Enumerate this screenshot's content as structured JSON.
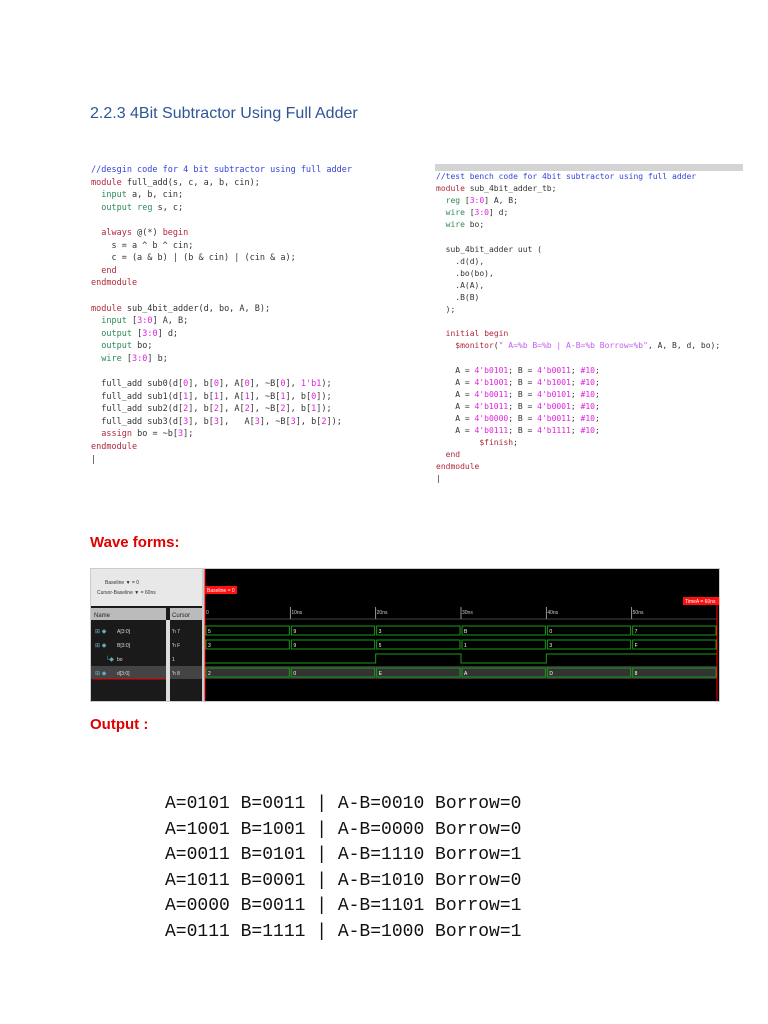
{
  "title": "2.2.3 4Bit Subtractor Using Full Adder",
  "design_code": [
    "//desgin code for 4 bit subtractor using full adder",
    "module full_add(s, c, a, b, cin);",
    "  input a, b, cin;",
    "  output reg s, c;",
    "",
    "  always @(*) begin",
    "    s = a ^ b ^ cin;",
    "    c = (a & b) | (b & cin) | (cin & a);",
    "  end",
    "endmodule",
    "",
    "module sub_4bit_adder(d, bo, A, B);",
    "  input [3:0] A, B;",
    "  output [3:0] d;",
    "  output bo;",
    "  wire [3:0] b;",
    "",
    "  full_add sub0(d[0], b[0], A[0], ~B[0], 1'b1);",
    "  full_add sub1(d[1], b[1], A[1], ~B[1], b[0]);",
    "  full_add sub2(d[2], b[2], A[2], ~B[2], b[1]);",
    "  full_add sub3(d[3], b[3],   A[3], ~B[3], b[2]);",
    "  assign bo = ~b[3];",
    "endmodule",
    "|"
  ],
  "testbench_code": [
    "//test bench code for 4bit subtractor using full adder",
    "module sub_4bit_adder_tb;",
    "  reg [3:0] A, B;",
    "  wire [3:0] d;",
    "  wire bo;",
    "",
    "  sub_4bit_adder uut (",
    "    .d(d),",
    "    .bo(bo),",
    "    .A(A),",
    "    .B(B)",
    "  );",
    "",
    "  initial begin",
    "    $monitor(\" A=%b B=%b | A-B=%b Borrow=%b\", A, B, d, bo);",
    "",
    "    A = 4'b0101; B = 4'b0011; #10;",
    "    A = 4'b1001; B = 4'b1001; #10;",
    "    A = 4'b0011; B = 4'b0101; #10;",
    "    A = 4'b1011; B = 4'b0001; #10;",
    "    A = 4'b0000; B = 4'b0011; #10;",
    "    A = 4'b0111; B = 4'b1111; #10;",
    "         $finish;",
    "  end",
    "endmodule",
    "|"
  ],
  "waveforms_label": "Wave forms:",
  "waveform": {
    "baseline_label": "Baseline ▼ = 0",
    "cursor_baseline_label": "Cursor-Baseline ▼ = 60ns",
    "baseline_marker": "Baseline = 0",
    "timea_marker": "TimeA = 60ns",
    "name_header": "Name",
    "cursor_header": "Cursor",
    "ticks": [
      "0",
      "10ns",
      "20ns",
      "30ns",
      "40ns",
      "50ns"
    ],
    "time_max_ns": 60,
    "signals": [
      {
        "name": "A[3:0]",
        "cursor": "'h 7",
        "bus": true,
        "values": [
          "5",
          "9",
          "3",
          "B",
          "0",
          "7"
        ]
      },
      {
        "name": "B[3:0]",
        "cursor": "'h F",
        "bus": true,
        "values": [
          "3",
          "9",
          "5",
          "1",
          "3",
          "F"
        ]
      },
      {
        "name": "bo",
        "cursor": "1",
        "bus": false,
        "levels": [
          0,
          0,
          1,
          0,
          1,
          1
        ]
      },
      {
        "name": "d[3:0]",
        "cursor": "'h 8",
        "bus": true,
        "values": [
          "2",
          "0",
          "E",
          "A",
          "D",
          "8"
        ]
      }
    ]
  },
  "output_label": "Output :",
  "output_lines": [
    "A=0101 B=0011 | A-B=0010 Borrow=0",
    "A=1001 B=1001 | A-B=0000 Borrow=0",
    "A=0011 B=0101 | A-B=1110 Borrow=1",
    "A=1011 B=0001 | A-B=1010 Borrow=0",
    "A=0000 B=0011 | A-B=1101 Borrow=1",
    "A=0111 B=1111 | A-B=1000 Borrow=1"
  ]
}
